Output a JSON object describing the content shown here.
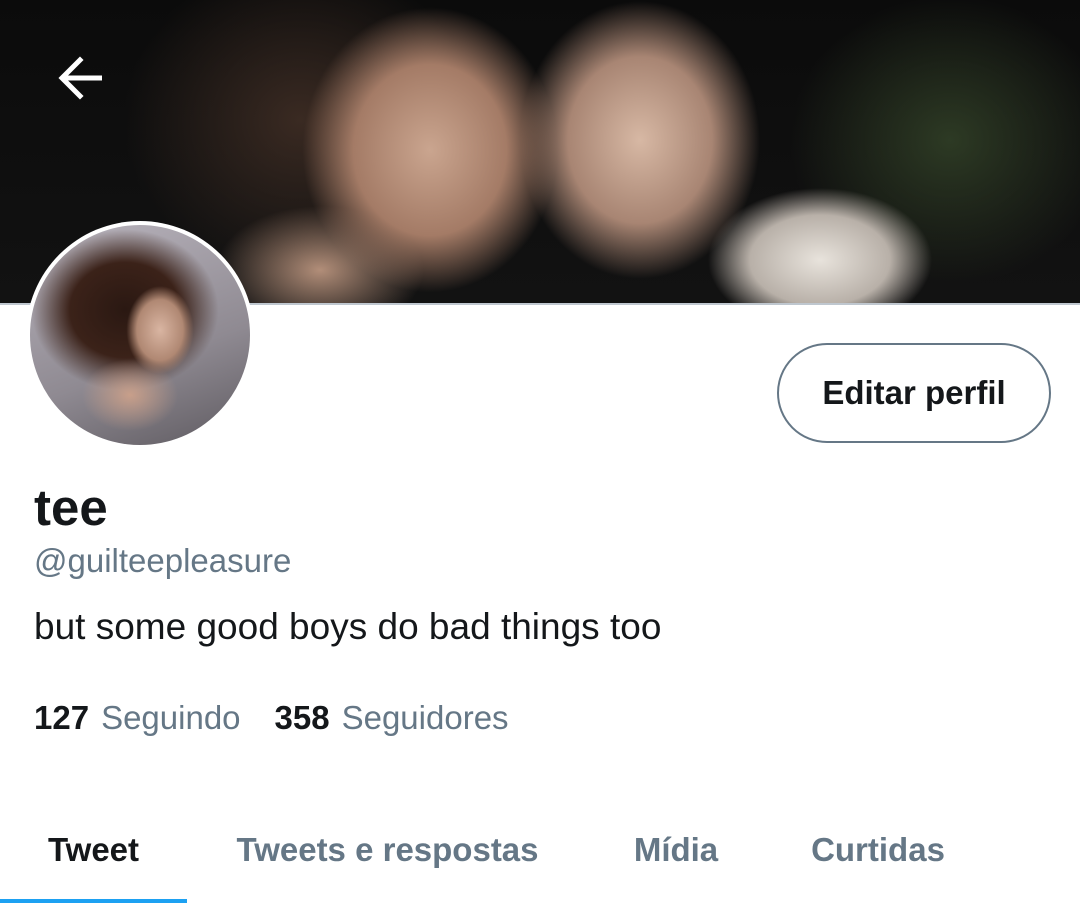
{
  "header": {
    "back_icon": "arrow-left-icon"
  },
  "profile": {
    "display_name": "tee",
    "handle": "@guilteepleasure",
    "bio": "but some good boys do bad things too",
    "edit_button_label": "Editar perfil"
  },
  "stats": {
    "following_count": "127",
    "following_label": "Seguindo",
    "followers_count": "358",
    "followers_label": "Seguidores"
  },
  "tabs": [
    {
      "label": "Tweet",
      "active": true
    },
    {
      "label": "Tweets e respostas",
      "active": false
    },
    {
      "label": "Mídia",
      "active": false
    },
    {
      "label": "Curtidas",
      "active": false
    }
  ],
  "colors": {
    "accent": "#1da1f2",
    "text_primary": "#14171a",
    "text_secondary": "#657786"
  }
}
